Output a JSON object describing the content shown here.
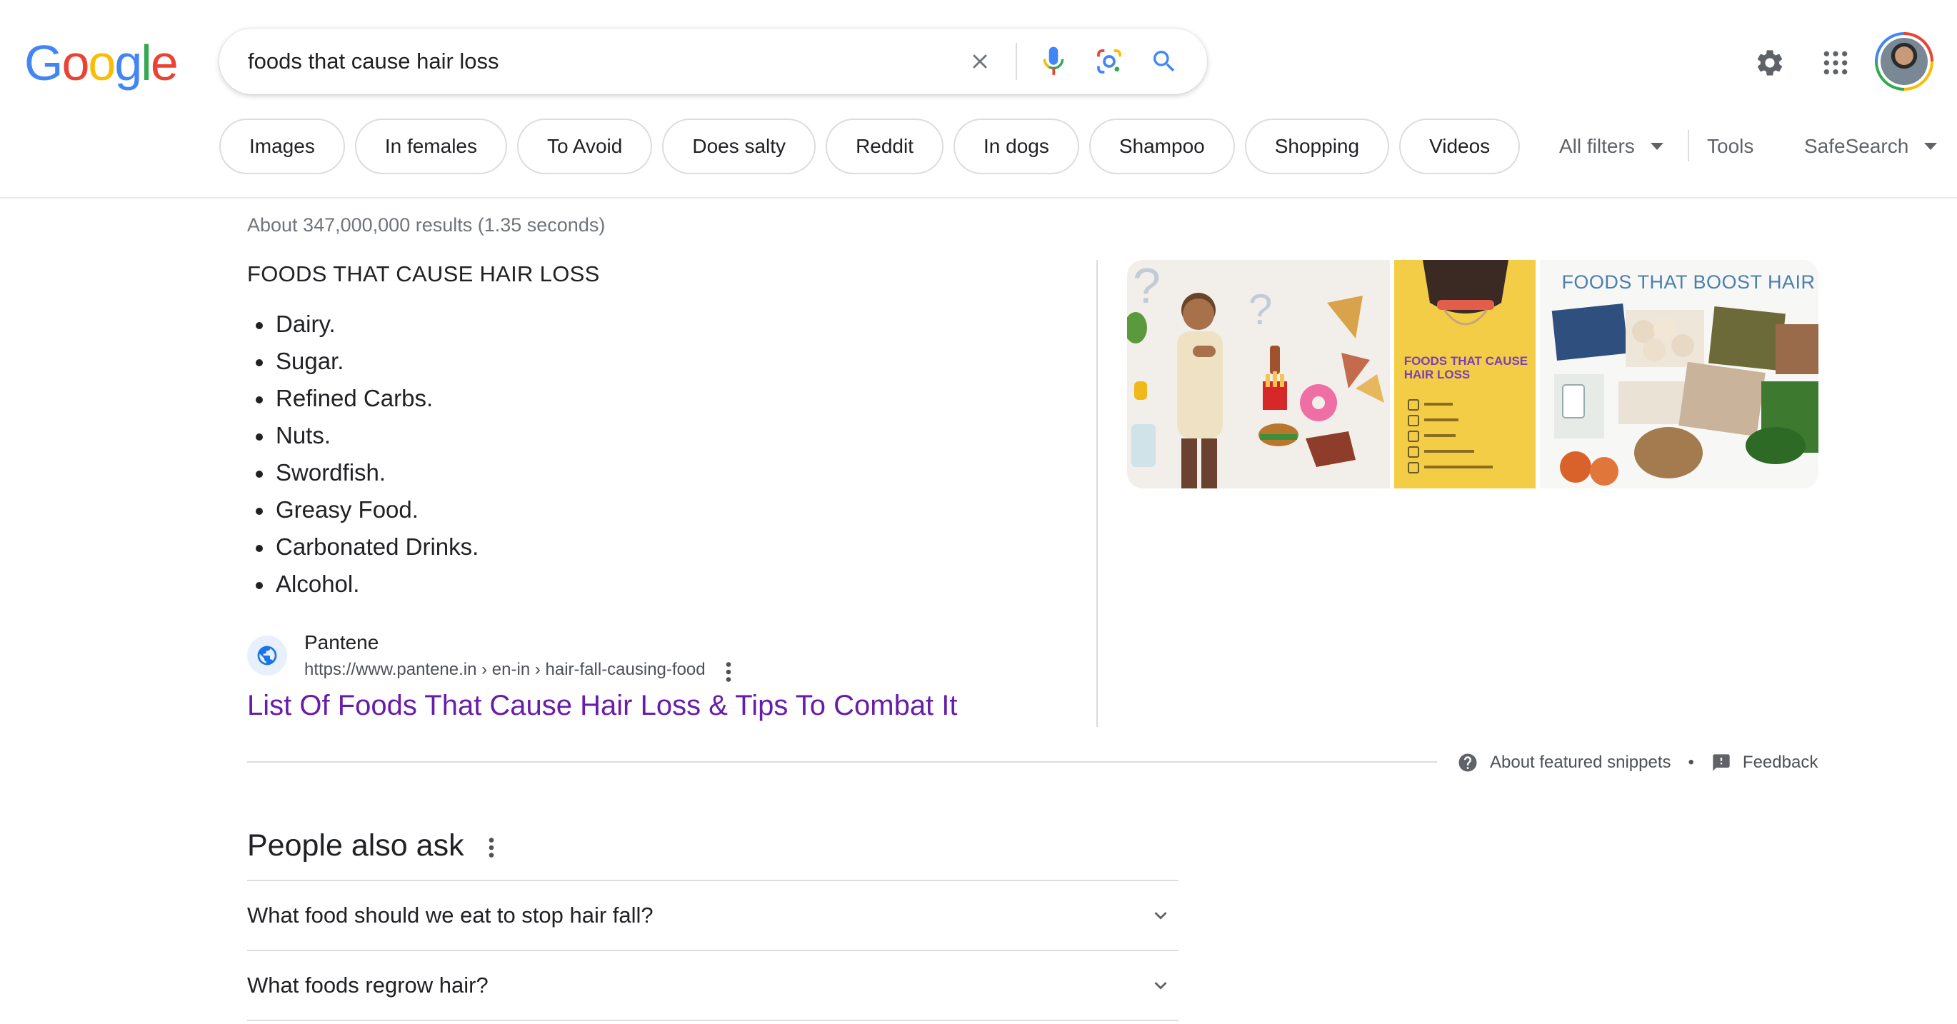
{
  "header": {
    "logo_letters": [
      "G",
      "o",
      "o",
      "g",
      "l",
      "e"
    ],
    "logo_colors": [
      "#4285f4",
      "#ea4335",
      "#fbbc05",
      "#4285f4",
      "#34a853",
      "#ea4335"
    ],
    "search_query": "foods that cause hair loss",
    "icons": {
      "clear": "close-icon",
      "voice": "microphone-icon",
      "lens": "camera-lens-icon",
      "search": "search-icon",
      "settings": "gear-icon",
      "apps": "apps-grid-icon"
    }
  },
  "chips": [
    "Images",
    "In females",
    "To Avoid",
    "Does salty",
    "Reddit",
    "In dogs",
    "Shampoo",
    "Shopping",
    "Videos"
  ],
  "tools": {
    "all_filters": "All filters",
    "tools": "Tools",
    "safesearch": "SafeSearch"
  },
  "results": {
    "stats": "About 347,000,000 results (1.35 seconds)"
  },
  "snippet": {
    "heading": "FOODS THAT CAUSE HAIR LOSS",
    "items": [
      "Dairy.",
      "Sugar.",
      "Refined Carbs.",
      "Nuts.",
      "Swordfish.",
      "Greasy Food.",
      "Carbonated Drinks.",
      "Alcohol."
    ],
    "images": {
      "image2_title": "FOODS THAT CAUSE HAIR LOSS",
      "image3_title": "FOODS THAT BOOST HAIR"
    },
    "source": {
      "name": "Pantene",
      "url": "https://www.pantene.in › en-in › hair-fall-causing-food"
    },
    "title": "List Of Foods That Cause Hair Loss & Tips To Combat It",
    "footer": {
      "about": "About featured snippets",
      "separator": "•",
      "feedback": "Feedback"
    }
  },
  "people_also_ask": {
    "title": "People also ask",
    "questions": [
      "What food should we eat to stop hair fall?",
      "What foods regrow hair?"
    ]
  },
  "colors": {
    "link_visited": "#681da8",
    "text": "#202124",
    "muted": "#70757a",
    "border": "#dadce0",
    "accent_blue": "#4285f4"
  }
}
